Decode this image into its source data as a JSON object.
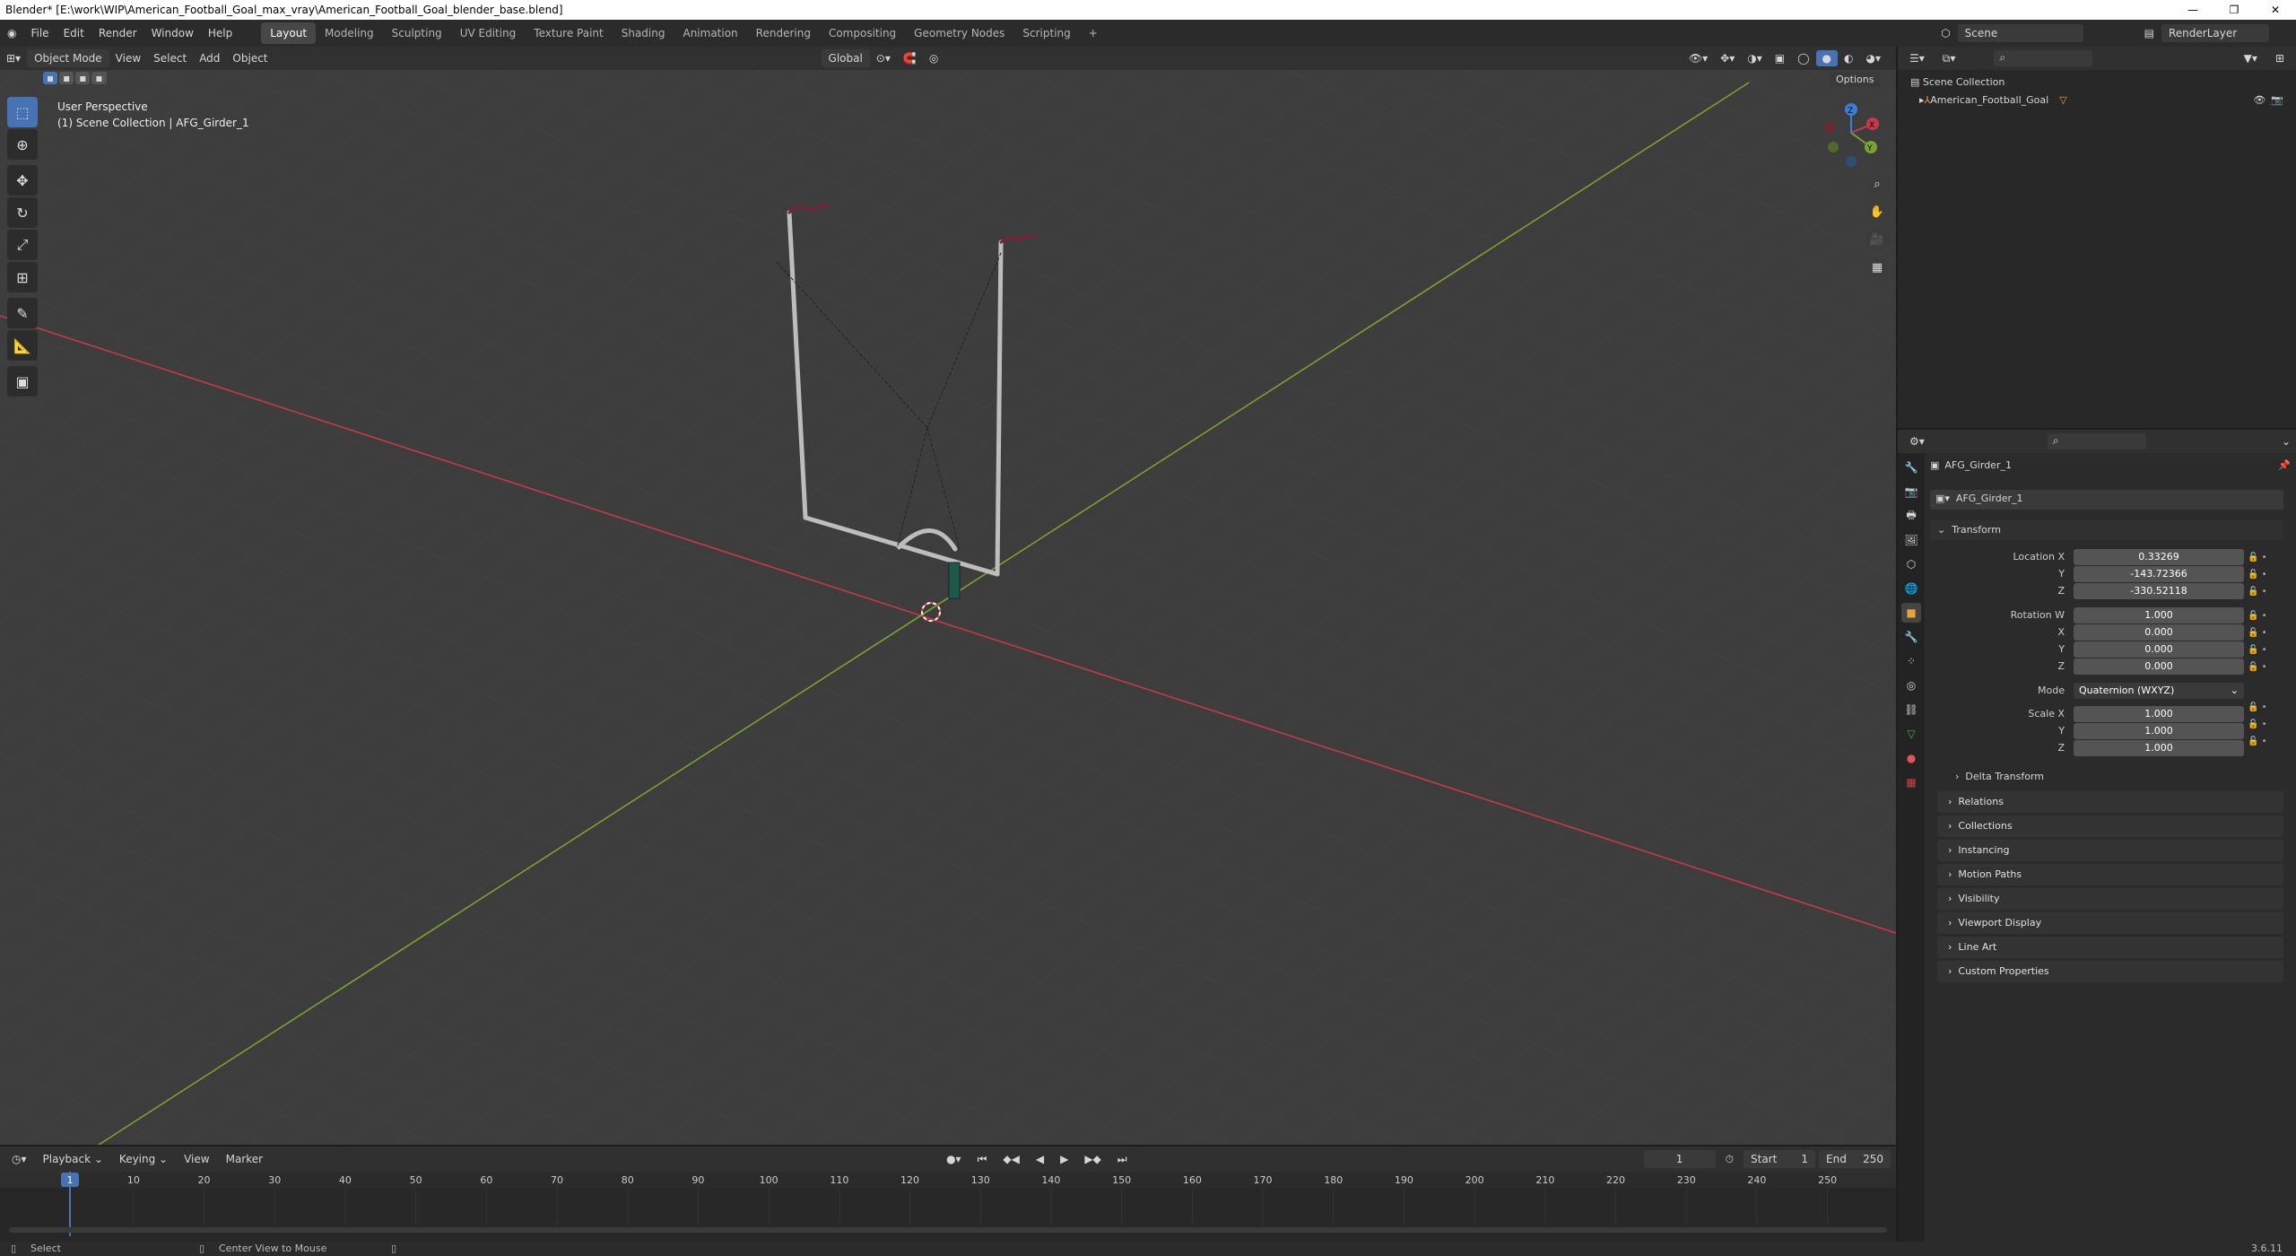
{
  "window": {
    "title": "Blender* [E:\\work\\WIP\\American_Football_Goal_max_vray\\American_Football_Goal_blender_base.blend]",
    "minimize": "—",
    "maximize": "❐",
    "close": "✕"
  },
  "menu": [
    "File",
    "Edit",
    "Render",
    "Window",
    "Help"
  ],
  "workspaces": [
    "Layout",
    "Modeling",
    "Sculpting",
    "UV Editing",
    "Texture Paint",
    "Shading",
    "Animation",
    "Rendering",
    "Compositing",
    "Geometry Nodes",
    "Scripting",
    "+"
  ],
  "scene": {
    "label": "Scene",
    "renderlayer": "RenderLayer"
  },
  "viewport": {
    "mode": "Object Mode",
    "menus": [
      "View",
      "Select",
      "Add",
      "Object"
    ],
    "transform": "Global",
    "options": "Options",
    "info_line1": "User Perspective",
    "info_line2": "(1) Scene Collection | AFG_Girder_1"
  },
  "gizmo": {
    "x": "X",
    "y": "Y",
    "z": "Z"
  },
  "outliner": {
    "root": "Scene Collection",
    "item": "American_Football_Goal"
  },
  "properties": {
    "object_name": "AFG_Girder_1",
    "data_name": "AFG_Girder_1",
    "panel": "Transform",
    "location_label": "Location X",
    "loc": [
      "0.33269",
      "-143.72366",
      "-330.52118"
    ],
    "rotation_label": "Rotation W",
    "rot": [
      "1.000",
      "0.000",
      "0.000",
      "0.000"
    ],
    "mode_label": "Mode",
    "mode_value": "Quaternion (WXYZ)",
    "scale_label": "Scale X",
    "scale": [
      "1.000",
      "1.000",
      "1.000"
    ],
    "ylabel": "Y",
    "zlabel": "Z",
    "xlabel": "X",
    "delta": "Delta Transform",
    "panels": [
      "Relations",
      "Collections",
      "Instancing",
      "Motion Paths",
      "Visibility",
      "Viewport Display",
      "Line Art",
      "Custom Properties"
    ]
  },
  "timeline": {
    "menus": [
      "Playback",
      "Keying",
      "View",
      "Marker"
    ],
    "current": "1",
    "start_label": "Start",
    "start": "1",
    "end_label": "End",
    "end": "250",
    "ticks": [
      "10",
      "20",
      "30",
      "40",
      "50",
      "60",
      "70",
      "80",
      "90",
      "100",
      "110",
      "120",
      "130",
      "140",
      "150",
      "160",
      "170",
      "180",
      "190",
      "200",
      "210",
      "220",
      "230",
      "240",
      "250"
    ]
  },
  "status": {
    "select": "Select",
    "center": "Center View to Mouse",
    "version": "3.6.11"
  },
  "colors": {
    "accent": "#4772b3",
    "x_axis": "#c53a47",
    "y_axis": "#7ba22b",
    "z_axis": "#3b7ed8"
  }
}
